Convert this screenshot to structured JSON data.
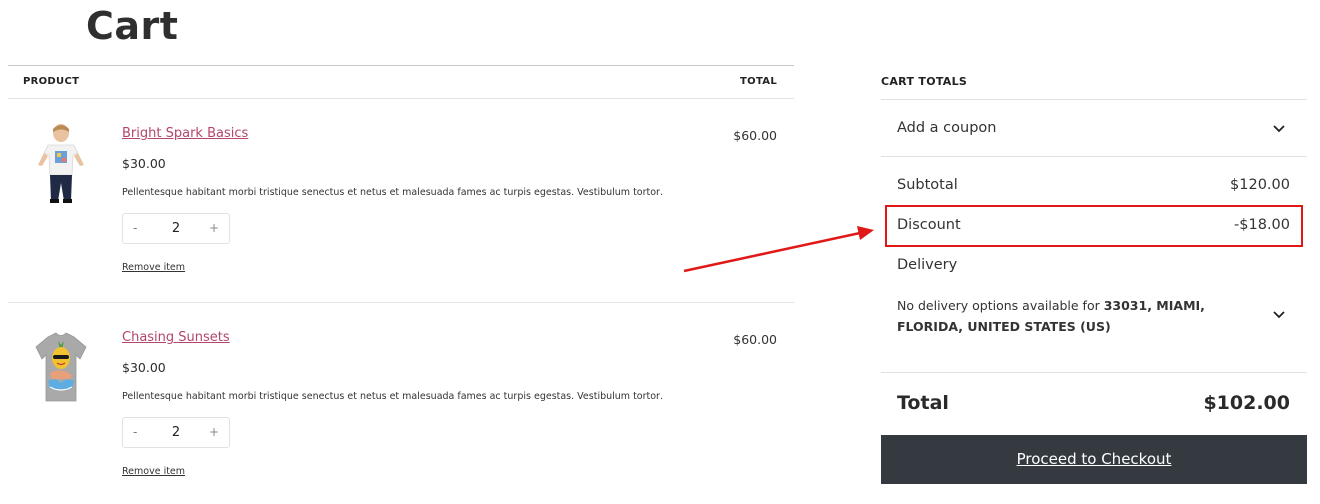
{
  "page": {
    "title": "Cart"
  },
  "table": {
    "product_header": "PRODUCT",
    "total_header": "TOTAL",
    "items": [
      {
        "name": "Bright Spark Basics",
        "price": "$30.00",
        "description": "Pellentesque habitant morbi tristique senectus et netus et malesuada fames ac turpis egestas. Vestibulum tortor…",
        "quantity": "2",
        "minus": "-",
        "plus": "+",
        "remove": "Remove item",
        "line_total": "$60.00",
        "image": "kid-white-tshirt-photo"
      },
      {
        "name": "Chasing Sunsets",
        "price": "$30.00",
        "description": "Pellentesque habitant morbi tristique senectus et netus et malesuada fames ac turpis egestas. Vestibulum tortor…",
        "quantity": "2",
        "minus": "-",
        "plus": "+",
        "remove": "Remove item",
        "line_total": "$60.00",
        "image": "grey-pineapple-tshirt"
      }
    ]
  },
  "totals": {
    "title": "CART TOTALS",
    "coupon_label": "Add a coupon",
    "subtotal_label": "Subtotal",
    "subtotal_value": "$120.00",
    "discount_label": "Discount",
    "discount_value": "-$18.00",
    "delivery_label": "Delivery",
    "delivery_note_prefix": "No delivery options available for ",
    "delivery_note_location": "33031, MIAMI, FLORIDA, UNITED STATES (US)",
    "total_label": "Total",
    "total_value": "$102.00",
    "checkout_label": "Proceed to Checkout"
  },
  "annotation": {
    "color": "#e01818"
  },
  "colors": {
    "link": "#b4466b",
    "checkout_bg": "#353a40"
  }
}
